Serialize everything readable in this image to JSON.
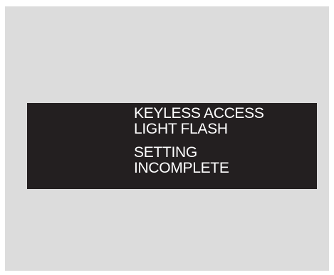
{
  "display": {
    "background_color": "#231f20",
    "text_color": "#ffffff",
    "title_lines": [
      "KEYLESS ACCESS",
      "LIGHT FLASH"
    ],
    "status_lines": [
      "SETTING",
      "INCOMPLETE"
    ]
  },
  "frame": {
    "background_color": "#dcdcdc"
  }
}
